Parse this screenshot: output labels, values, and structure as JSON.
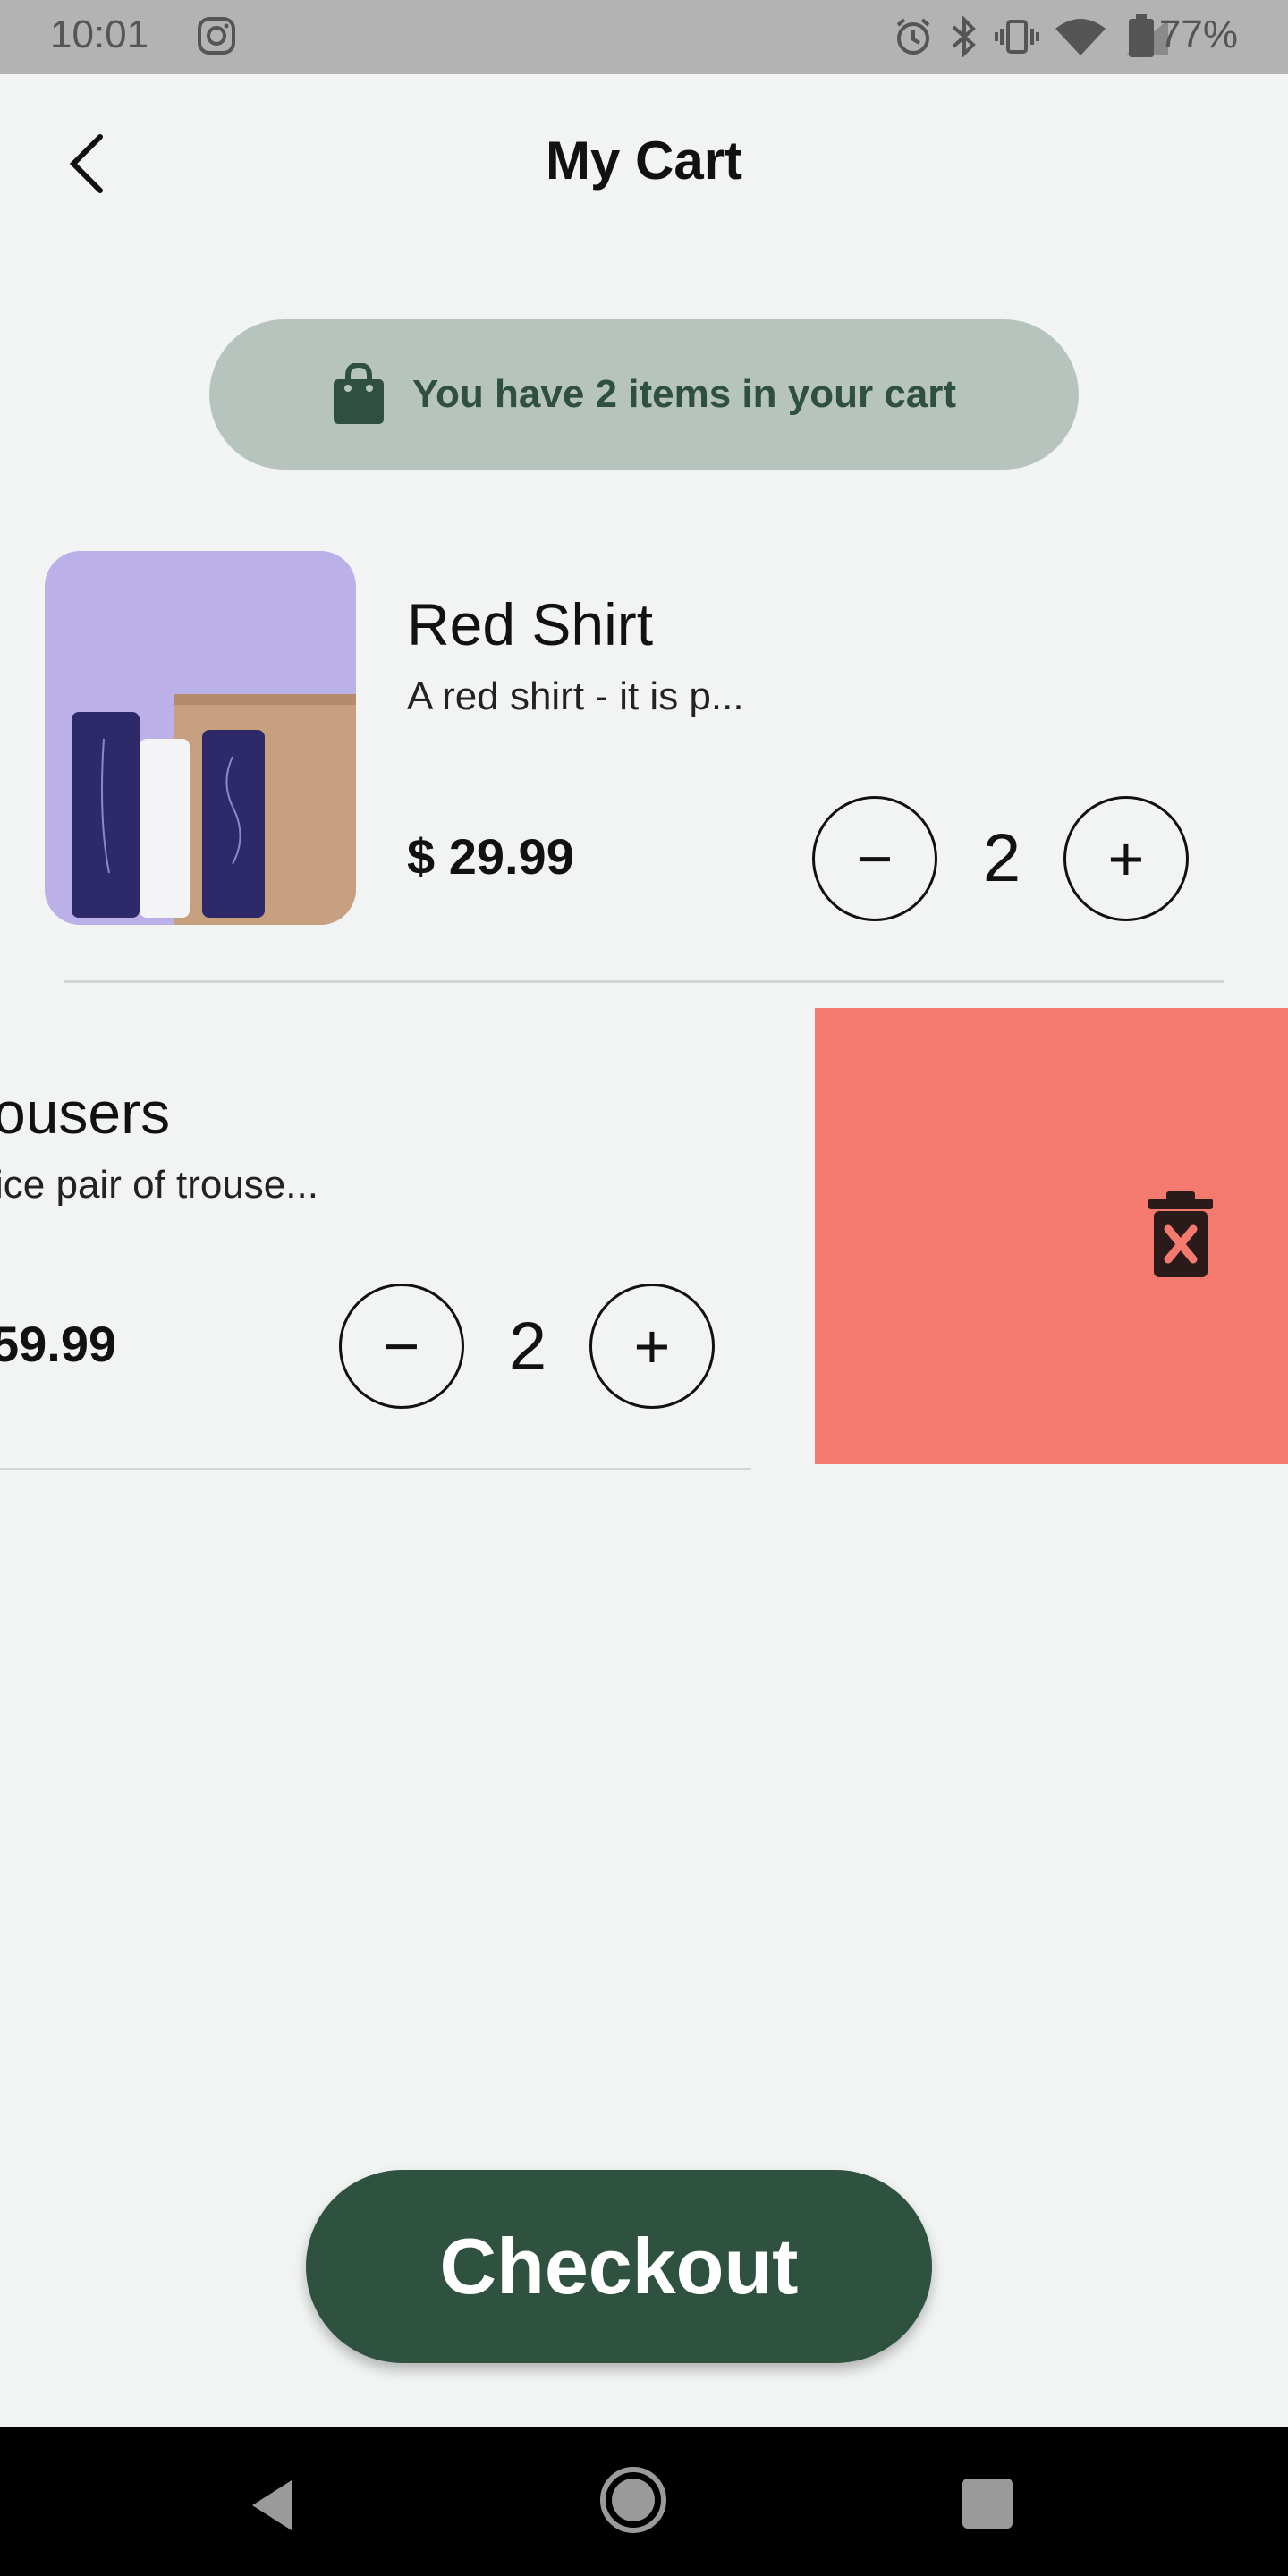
{
  "status_bar": {
    "time": "10:01",
    "battery": "77%",
    "icons": [
      "instagram-icon",
      "alarm-icon",
      "bluetooth-icon",
      "vibrate-icon",
      "wifi-icon",
      "signal-icon",
      "battery-icon"
    ]
  },
  "header": {
    "title": "My Cart"
  },
  "banner": {
    "text": "You have 2 items  in your cart"
  },
  "items": [
    {
      "name": "Red Shirt",
      "description": "A red shirt - it is p...",
      "price": "$ 29.99",
      "quantity": "2",
      "minus_label": "−",
      "plus_label": "+"
    },
    {
      "name": "ousers",
      "description": "ice pair of trouse...",
      "price": "59.99",
      "quantity": "2",
      "minus_label": "−",
      "plus_label": "+"
    }
  ],
  "checkout": {
    "label": "Checkout"
  },
  "colors": {
    "accent": "#2e5140",
    "banner_bg": "#b6c4bd",
    "delete_bg": "#f4796e",
    "background": "#f2f4f3"
  }
}
